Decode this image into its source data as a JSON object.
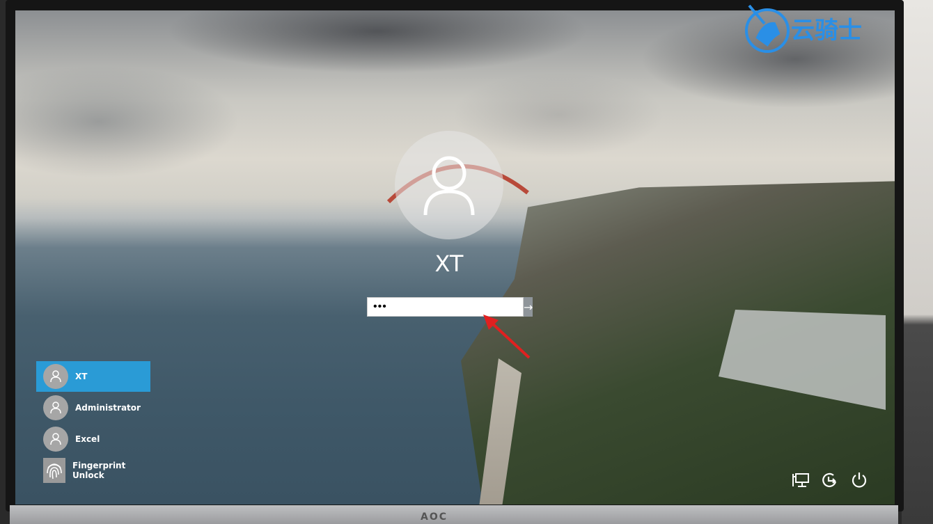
{
  "login": {
    "username": "XT",
    "password_masked": "•••",
    "submit_icon": "arrow-right-icon"
  },
  "user_list": [
    {
      "label": "XT",
      "icon": "user-icon",
      "selected": true
    },
    {
      "label": "Administrator",
      "icon": "user-icon",
      "selected": false
    },
    {
      "label": "Excel",
      "icon": "user-icon",
      "selected": false
    },
    {
      "label": "Fingerprint Unlock",
      "icon": "fingerprint-icon",
      "selected": false
    }
  ],
  "system_icons": [
    "network-icon",
    "accessibility-icon",
    "power-icon"
  ],
  "watermark": {
    "text": "云骑士",
    "color": "#2a8fe6"
  },
  "monitor_brand": "AOC",
  "colors": {
    "selected_user": "#2a9bd6",
    "annotation_arrow": "#e02020"
  }
}
